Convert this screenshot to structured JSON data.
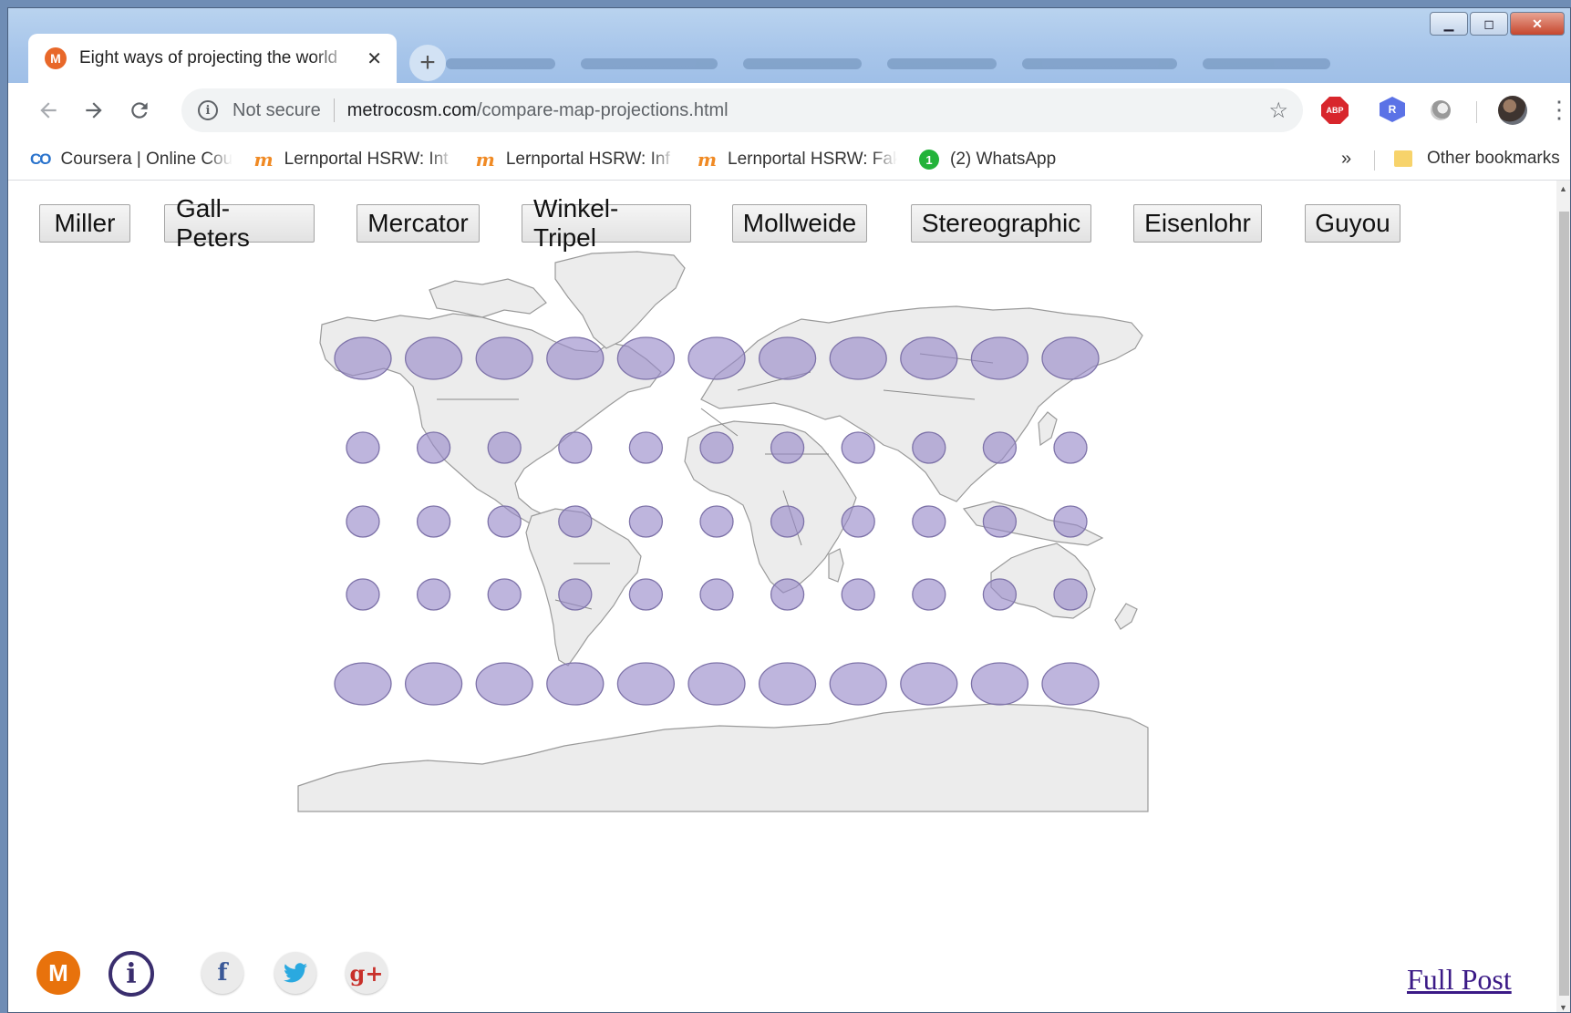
{
  "browser": {
    "tab_title": "Eight ways of projecting the world",
    "tab_favicon_letter": "M",
    "tab_close": "✕",
    "new_tab": "+",
    "not_secure": "Not secure",
    "url_domain": "metrocosm.com",
    "url_path": "/compare-map-projections.html",
    "ext_abp": "ABP",
    "ext_r": "R",
    "window_controls": {
      "minimize": "▁",
      "maximize": "◻",
      "close": "✕"
    }
  },
  "bookmarks": {
    "items": [
      {
        "icon": "coursera-icon",
        "label": "Coursera | Online Courses"
      },
      {
        "icon": "moodle-icon",
        "label": "Lernportal HSRW: Int"
      },
      {
        "icon": "moodle-icon",
        "label": "Lernportal HSRW: Inf"
      },
      {
        "icon": "moodle-icon",
        "label": "Lernportal HSRW: Fak"
      },
      {
        "icon": "whatsapp-icon",
        "label": "(2) WhatsApp",
        "badge": "1"
      }
    ],
    "overflow": "»",
    "other": "Other bookmarks"
  },
  "page": {
    "projections": [
      "Miller",
      "Gall-Peters",
      "Mercator",
      "Winkel-Tripel",
      "Mollweide",
      "Stereographic",
      "Eisenlohr",
      "Guyou"
    ],
    "logo_letter": "M",
    "info_symbol": "i",
    "social": {
      "facebook": "f",
      "twitter": "t",
      "googleplus": "g+"
    },
    "full_post_link": "Full Post",
    "colors": {
      "land": "#ececec",
      "tissot_fill": "#9687c8",
      "link": "#3b1a86",
      "logo": "#e8720c"
    }
  },
  "map": {
    "tissot_rows": [
      {
        "size": "large",
        "count": 11
      },
      {
        "size": "small",
        "count": 11
      },
      {
        "size": "small",
        "count": 11
      },
      {
        "size": "small",
        "count": 11
      },
      {
        "size": "large",
        "count": 11
      }
    ]
  }
}
